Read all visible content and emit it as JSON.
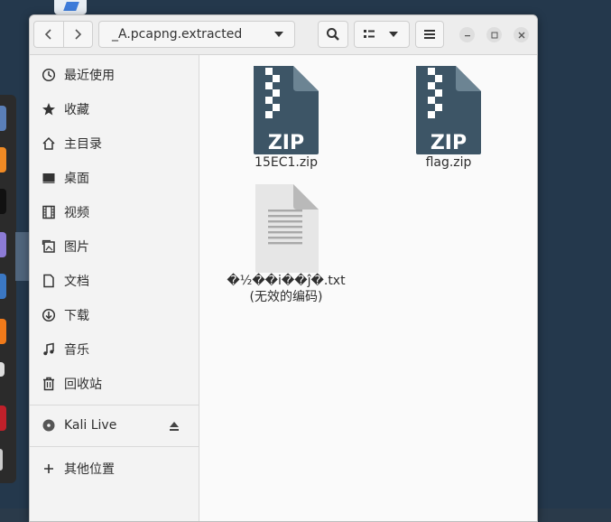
{
  "header": {
    "path": "_A.pcapng.extracted"
  },
  "sidebar": {
    "items": [
      {
        "label": "最近使用",
        "icon": "clock-icon"
      },
      {
        "label": "收藏",
        "icon": "star-icon"
      },
      {
        "label": "主目录",
        "icon": "home-icon"
      },
      {
        "label": "桌面",
        "icon": "desktop-icon"
      },
      {
        "label": "视频",
        "icon": "film-icon"
      },
      {
        "label": "图片",
        "icon": "image-icon"
      },
      {
        "label": "文档",
        "icon": "document-icon"
      },
      {
        "label": "下载",
        "icon": "download-icon"
      },
      {
        "label": "音乐",
        "icon": "music-icon"
      },
      {
        "label": "回收站",
        "icon": "trash-icon"
      }
    ],
    "devices": [
      {
        "label": "Kali Live",
        "icon": "disc-icon"
      }
    ],
    "other": {
      "label": "其他位置",
      "icon": "plus-icon"
    }
  },
  "files": [
    {
      "name": "15EC1.zip",
      "type": "zip",
      "badge": "ZIP"
    },
    {
      "name": "flag.zip",
      "type": "zip",
      "badge": "ZIP"
    },
    {
      "name": "�½��i��ĵ�.txt",
      "sub": "(无效的编码)",
      "type": "text"
    }
  ],
  "colors": {
    "zip_icon": "#3d5566",
    "zip_fold": "#6c8493",
    "accent": "#f6f6f6"
  }
}
